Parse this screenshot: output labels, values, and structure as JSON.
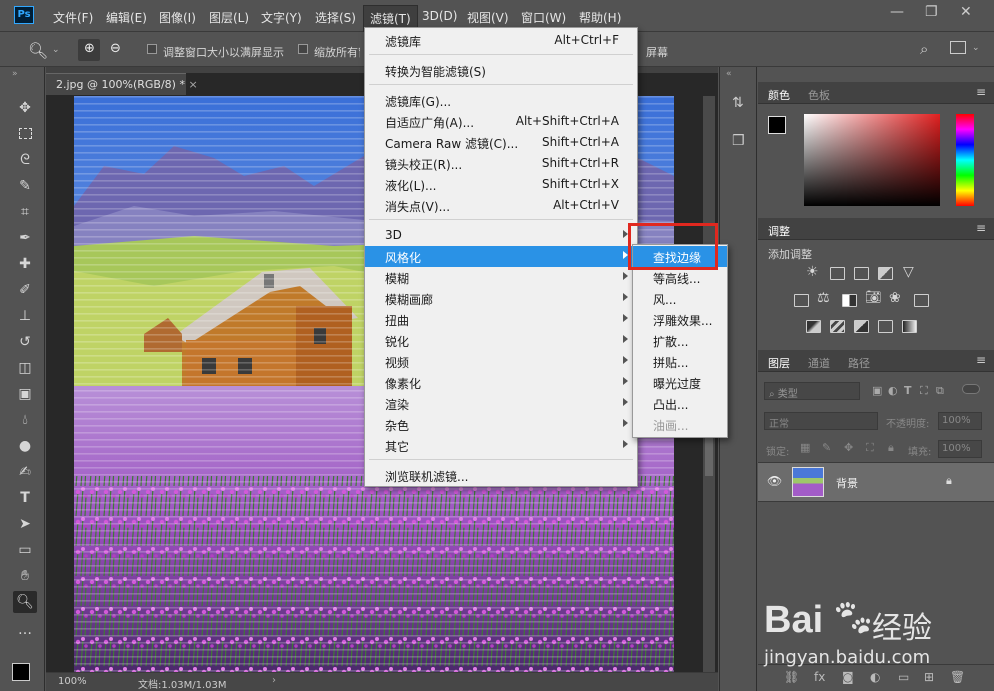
{
  "app": {
    "logo": "Ps"
  },
  "menubar": {
    "items": [
      "文件(F)",
      "编辑(E)",
      "图像(I)",
      "图层(L)",
      "文字(Y)",
      "选择(S)",
      "滤镜(T)",
      "3D(D)",
      "视图(V)",
      "窗口(W)",
      "帮助(H)"
    ],
    "active": "滤镜(T)"
  },
  "window_controls": {
    "minimize": "—",
    "restore": "❐",
    "close": "✕"
  },
  "options_bar": {
    "resize_windows": "调整窗口大小以满屏显示",
    "zoom_all": "缩放所有窗口",
    "fill_screen": "屏幕"
  },
  "document": {
    "tab_title": "2.jpg @ 100%(RGB/8) *",
    "zoom": "100%",
    "doc_info": "文档:1.03M/1.03M"
  },
  "filter_menu": {
    "items": [
      {
        "label": "滤镜库",
        "shortcut": "Alt+Ctrl+F"
      },
      {
        "sep": true
      },
      {
        "label": "转换为智能滤镜(S)",
        "shortcut": ""
      },
      {
        "sep": true
      },
      {
        "label": "滤镜库(G)...",
        "shortcut": ""
      },
      {
        "label": "自适应广角(A)...",
        "shortcut": "Alt+Shift+Ctrl+A"
      },
      {
        "label": "Camera Raw 滤镜(C)...",
        "shortcut": "Shift+Ctrl+A"
      },
      {
        "label": "镜头校正(R)...",
        "shortcut": "Shift+Ctrl+R"
      },
      {
        "label": "液化(L)...",
        "shortcut": "Shift+Ctrl+X"
      },
      {
        "label": "消失点(V)...",
        "shortcut": "Alt+Ctrl+V"
      },
      {
        "sep": true
      },
      {
        "label": "3D",
        "submenu": true
      },
      {
        "label": "风格化",
        "submenu": true,
        "highlighted": true
      },
      {
        "label": "模糊",
        "submenu": true
      },
      {
        "label": "模糊画廊",
        "submenu": true
      },
      {
        "label": "扭曲",
        "submenu": true
      },
      {
        "label": "锐化",
        "submenu": true
      },
      {
        "label": "视频",
        "submenu": true
      },
      {
        "label": "像素化",
        "submenu": true
      },
      {
        "label": "渲染",
        "submenu": true
      },
      {
        "label": "杂色",
        "submenu": true
      },
      {
        "label": "其它",
        "submenu": true
      },
      {
        "sep": true
      },
      {
        "label": "浏览联机滤镜...",
        "shortcut": ""
      }
    ]
  },
  "stylize_submenu": {
    "items": [
      {
        "label": "查找边缘",
        "highlighted": true
      },
      {
        "label": "等高线..."
      },
      {
        "label": "风..."
      },
      {
        "label": "浮雕效果..."
      },
      {
        "label": "扩散..."
      },
      {
        "label": "拼贴..."
      },
      {
        "label": "曝光过度"
      },
      {
        "label": "凸出..."
      },
      {
        "label": "油画...",
        "disabled": true
      }
    ]
  },
  "color_panel": {
    "tabs": [
      "颜色",
      "色板"
    ]
  },
  "adjustments_panel": {
    "tab": "调整",
    "add_label": "添加调整"
  },
  "layers_panel": {
    "tabs": [
      "图层",
      "通道",
      "路径"
    ],
    "filter_kind": "类型",
    "blend_mode": "正常",
    "opacity_label": "不透明度:",
    "opacity": "100%",
    "lock_label": "锁定:",
    "fill_label": "填充:",
    "fill": "100%",
    "layer_name": "背景"
  },
  "watermark": {
    "brand": "Bai",
    "brand2": "经验",
    "url": "jingyan.baidu.com"
  }
}
